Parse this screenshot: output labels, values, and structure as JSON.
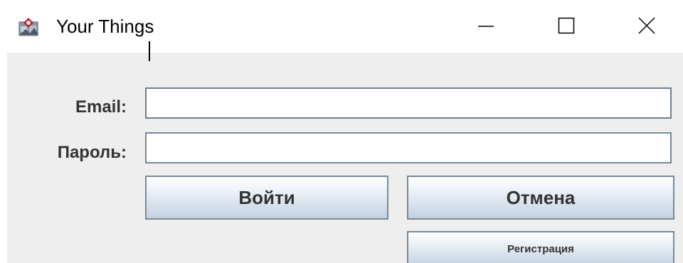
{
  "window": {
    "title": "Your Things",
    "icon": "java-app-icon",
    "controls": {
      "minimize_icon": "minimize-icon",
      "maximize_icon": "maximize-icon",
      "close_icon": "close-icon"
    }
  },
  "form": {
    "email_label": "Email:",
    "email_value": "",
    "password_label": "Пароль:",
    "password_value": ""
  },
  "buttons": {
    "login_label": "Войти",
    "cancel_label": "Отмена",
    "register_label": "Регистрация"
  },
  "colors": {
    "content_background": "#eeeeee",
    "label_text": "#333333",
    "field_border": "#7a8a99",
    "button_gradient_top": "#ffffff",
    "button_gradient_bottom": "#c3d1df"
  }
}
